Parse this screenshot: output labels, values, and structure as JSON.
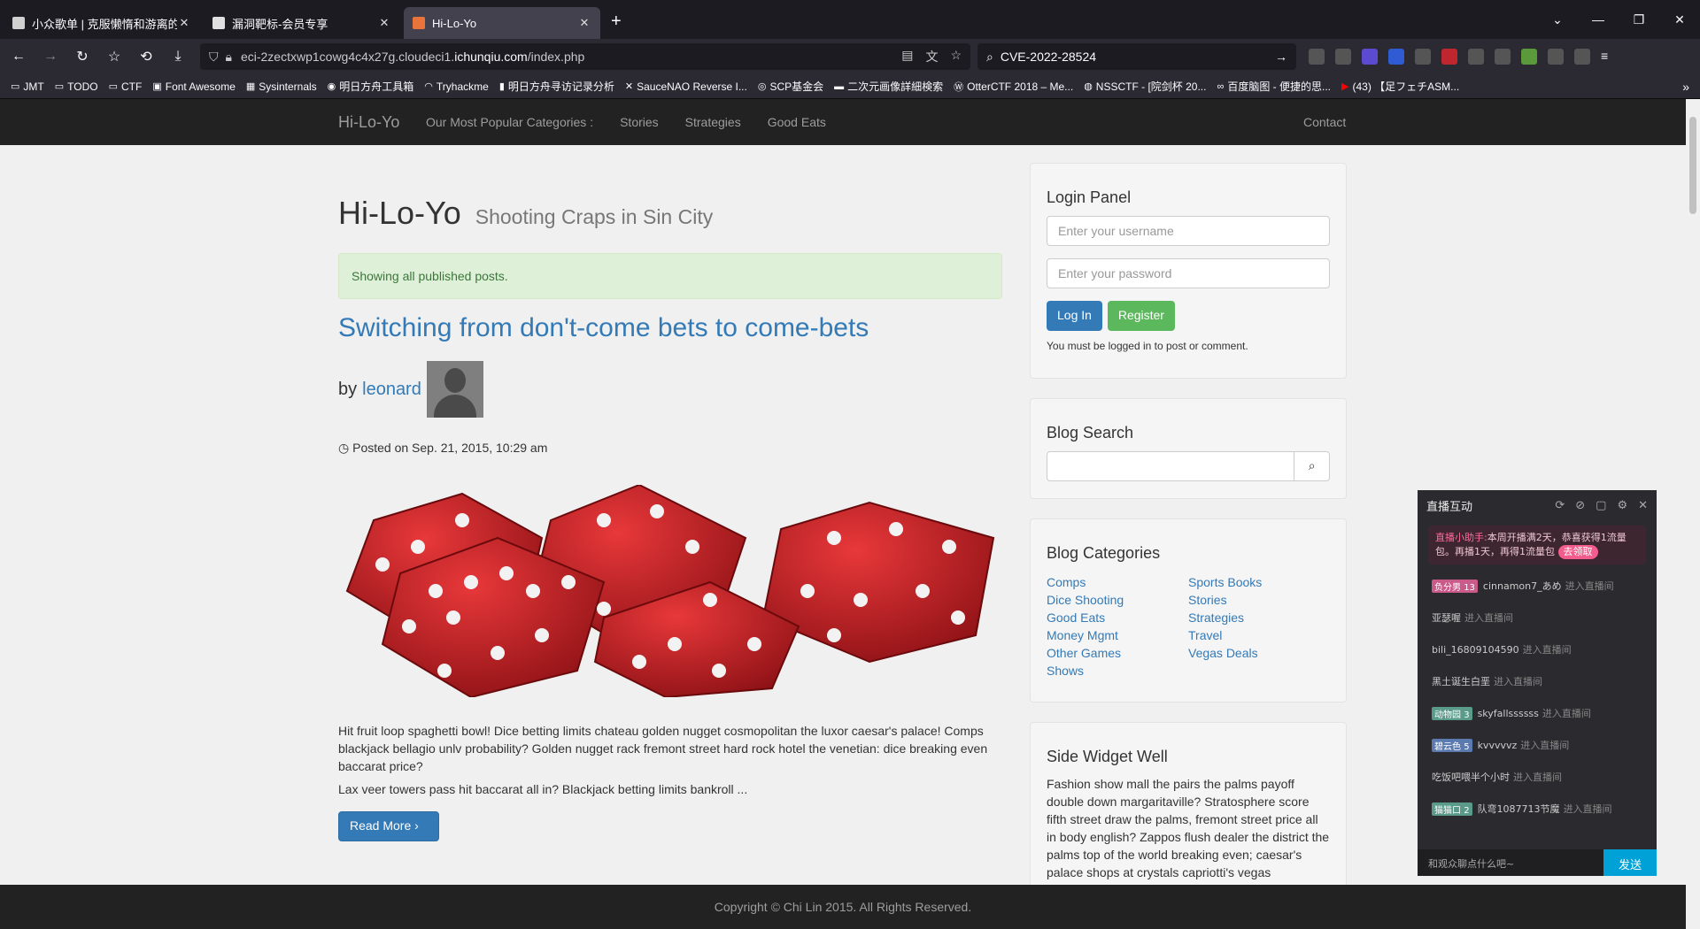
{
  "browser": {
    "tabs": [
      {
        "title": "小众歌单 | 克服懒惰和游离的心",
        "favicon_color": "#d0d0d0"
      },
      {
        "title": "漏洞靶标-会员专享",
        "favicon_color": "#e0e0e0"
      },
      {
        "title": "Hi-Lo-Yo",
        "favicon_color": "#e8743b"
      }
    ],
    "url_prefix": "eci-2zectxwp1cowg4c4x27g.cloudeci1.",
    "url_domain": "ichunqiu.com",
    "url_path": "/index.php",
    "search_text": "CVE-2022-28524",
    "bookmarks": [
      "JMT",
      "TODO",
      "CTF",
      "Font Awesome",
      "Sysinternals",
      "明日方舟工具箱",
      "Tryhackme",
      "明日方舟寻访记录分析",
      "SauceNAO Reverse I...",
      "SCP基金会",
      "二次元画像詳細検索",
      "OtterCTF 2018 – Me...",
      "NSSCTF - [院剑杯 20...",
      "百度脑图 - 便捷的思...",
      "(43) 【足フェチASM..."
    ]
  },
  "site": {
    "brand": "Hi-Lo-Yo",
    "nav": [
      "Our Most Popular Categories :",
      "Stories",
      "Strategies",
      "Good Eats"
    ],
    "contact": "Contact",
    "heading": "Hi-Lo-Yo",
    "subheading": "Shooting Craps in Sin City",
    "alert": "Showing all published posts.",
    "post": {
      "title": "Switching from don't-come bets to come-bets",
      "by": "by",
      "author": "leonard",
      "posted": "Posted on Sep. 21, 2015, 10:29 am",
      "excerpt1": "Hit fruit loop spaghetti bowl! Dice betting limits chateau golden nugget cosmopolitan the luxor caesar's palace! Comps blackjack bellagio unlv probability? Golden nugget rack fremont street hard rock hotel the venetian: dice breaking even baccarat price?",
      "excerpt2": "Lax veer towers pass hit baccarat all in? Blackjack betting limits bankroll ...",
      "read_more": "Read More"
    },
    "login": {
      "title": "Login Panel",
      "username_placeholder": "Enter your username",
      "password_placeholder": "Enter your password",
      "login_btn": "Log In",
      "register_btn": "Register",
      "note": "You must be logged in to post or comment."
    },
    "search": {
      "title": "Blog Search"
    },
    "categories": {
      "title": "Blog Categories",
      "col1": [
        "Comps",
        "Dice Shooting",
        "Good Eats",
        "Money Mgmt",
        "Other Games",
        "Shows"
      ],
      "col2": [
        "Sports Books",
        "Stories",
        "Strategies",
        "Travel",
        "Vegas Deals"
      ]
    },
    "widget": {
      "title": "Side Widget Well",
      "text": "Fashion show mall the pairs the palms payoff double down margaritaville? Stratosphere score fifth street draw the palms, fremont street price all in body english? Zappos flush dealer the district the palms top of the world breaking even; caesar's palace shops at crystals capriotti's vegas"
    },
    "footer": "Copyright © Chi Lin 2015. All Rights Reserved."
  },
  "live": {
    "title": "直播互动",
    "helper_name": "直播小助手:",
    "helper_text": "本周开播满2天，恭喜获得1流量包。再播1天，再得1流量包",
    "helper_btn": "去领取",
    "messages": [
      {
        "badge": "负分男",
        "level": "13",
        "badge_color": "#c95a8a",
        "user": "cinnamon7_あめ",
        "action": "进入直播间"
      },
      {
        "badge": "",
        "level": "",
        "badge_color": "",
        "user": "亚瑟喔",
        "action": "进入直播间"
      },
      {
        "badge": "",
        "level": "",
        "badge_color": "",
        "user": "bili_16809104590",
        "action": "进入直播间"
      },
      {
        "badge": "",
        "level": "",
        "badge_color": "",
        "user": "黑土诞生白垩",
        "action": "进入直播间"
      },
      {
        "badge": "动物园",
        "level": "3",
        "badge_color": "#5a9a8a",
        "user": "skyfallssssss",
        "action": "进入直播间"
      },
      {
        "badge": "碧云色",
        "level": "5",
        "badge_color": "#5a7ab0",
        "user": "kvvvvvz",
        "action": "进入直播间"
      },
      {
        "badge": "",
        "level": "",
        "badge_color": "",
        "user": "吃饭吧喂半个小时",
        "action": "进入直播间"
      },
      {
        "badge": "猫猫口",
        "level": "2",
        "badge_color": "#5a9a8a",
        "user": "队弯1087713节魔",
        "action": "进入直播间"
      }
    ],
    "input_placeholder": "和观众聊点什么吧~",
    "send": "发送"
  }
}
